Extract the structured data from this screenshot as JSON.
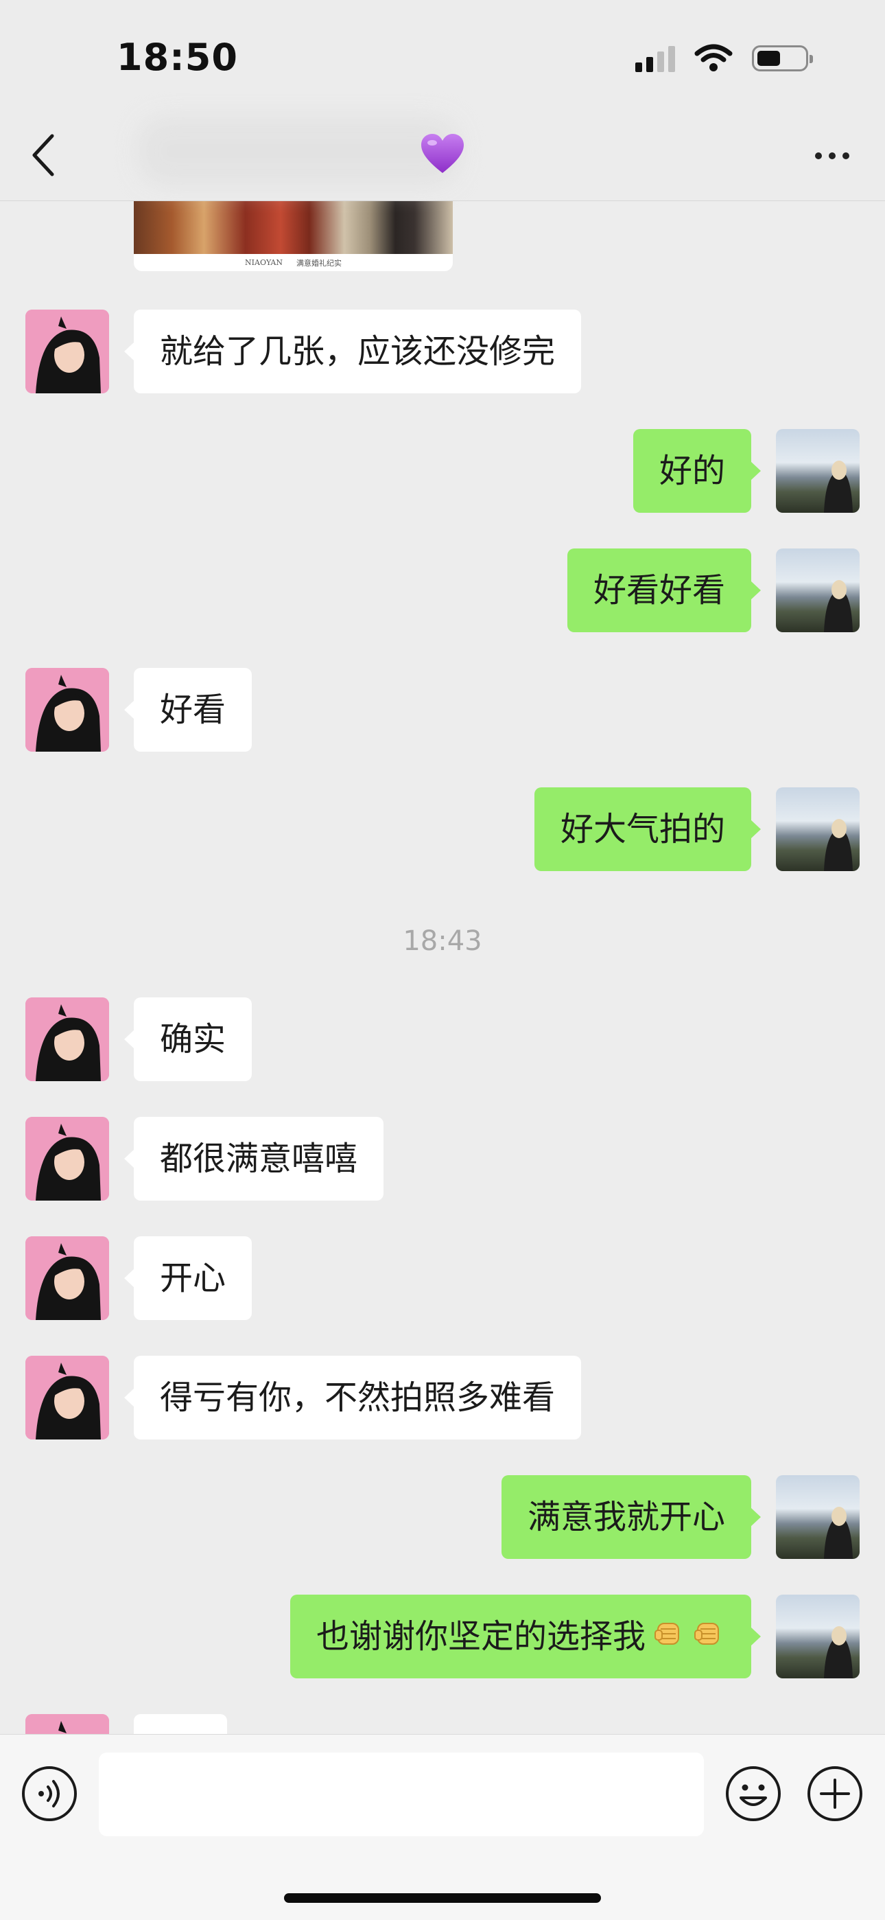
{
  "status_bar": {
    "time": "18:50",
    "battery_level": 0.5
  },
  "header": {
    "title_icon": "purple-heart-icon",
    "title_color": "#a64ad9"
  },
  "image_message": {
    "caption_left": "NIAOYAN",
    "caption_right": "满意婚礼纪实"
  },
  "messages": [
    {
      "side": "left",
      "text": "就给了几张，应该还没修完"
    },
    {
      "side": "right",
      "text": "好的"
    },
    {
      "side": "right",
      "text": "好看好看"
    },
    {
      "side": "left",
      "text": "好看"
    },
    {
      "side": "right",
      "text": "好大气拍的"
    },
    {
      "side": "left",
      "text": "确实"
    },
    {
      "side": "left",
      "text": "都很满意嘻嘻"
    },
    {
      "side": "left",
      "text": "开心"
    },
    {
      "side": "left",
      "text": "得亏有你，不然拍照多难看"
    },
    {
      "side": "right",
      "text": "满意我就开心"
    },
    {
      "side": "right",
      "text": "也谢谢你坚定的选择我"
    }
  ],
  "timestamp": "18:43",
  "input": {
    "value": ""
  },
  "colors": {
    "sent_bubble": "#95ec69",
    "received_bubble": "#ffffff",
    "background": "#ededed"
  }
}
